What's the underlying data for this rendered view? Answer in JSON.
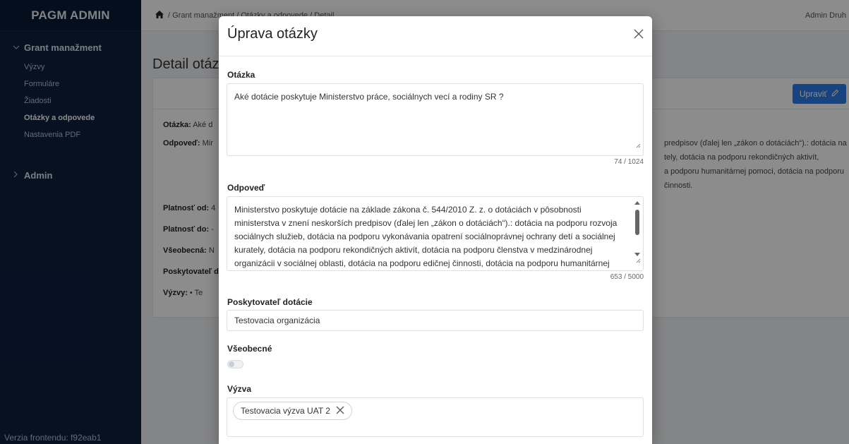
{
  "sidebar": {
    "brand": "PAGM ADMIN",
    "group_grant": "Grant manažment",
    "items": [
      {
        "label": "Výzvy",
        "active": false
      },
      {
        "label": "Formuláre",
        "active": false
      },
      {
        "label": "Žiadosti",
        "active": false
      },
      {
        "label": "Otázky a odpovede",
        "active": true
      },
      {
        "label": "Nastavenia PDF",
        "active": false
      }
    ],
    "group_admin": "Admin",
    "footer": "Verzia frontendu: f92eab1"
  },
  "topbar": {
    "breadcrumb": "/ Grant manažment / Otázky a odpovede / Detail",
    "user": "Admin Druh"
  },
  "page": {
    "title": "Detail otáz",
    "edit_label": "Upraviť",
    "rows": [
      {
        "label": "Otázka:",
        "value": "Aké d"
      },
      {
        "label": "Odpoveď:",
        "value": "Mir"
      },
      {
        "label": "Platnosť od:",
        "value": "4"
      },
      {
        "label": "Platnosť do:",
        "value": "-"
      },
      {
        "label": "Všeobecná:",
        "value": "N"
      },
      {
        "label": "Poskytovateľ d",
        "value": ""
      },
      {
        "label": "Výzvy:",
        "value": "• Te"
      }
    ],
    "answer_lines": [
      "predpisov (ďalej len „zákon o dotáciách“).: dotácia na",
      "tely, dotácia na podporu rekondičných aktivít,",
      "a podporu humanitárnej pomoci, dotácia na podporu",
      "činnosti."
    ]
  },
  "modal": {
    "title": "Úprava otázky",
    "question_label": "Otázka",
    "question_value": "Aké dotácie poskytuje Ministerstvo práce, sociálnych vecí a rodiny SR ?",
    "question_counter": "74 / 1024",
    "answer_label": "Odpoveď",
    "answer_value": "Ministerstvo poskytuje dotácie na základe zákona č. 544/2010 Z. z. o dotáciách v pôsobnosti ministerstva v znení neskorších predpisov (ďalej len „zákon o dotáciách“).: dotácia na podporu rozvoja sociálnych služieb, dotácia na podporu vykonávania opatrení sociálnoprávnej ochrany detí a sociálnej kurately, dotácia na podporu rekondičných aktivít, dotácia na podporu členstva v medzinárodnej organizácii v sociálnej oblasti, dotácia na podporu edičnej činnosti, dotácia na podporu humanitárnej pomoci, dotácia na podporu",
    "answer_counter": "653 / 5000",
    "provider_label": "Poskytovateľ dotácie",
    "provider_value": "Testovacia organizácia",
    "general_label": "Všeobecné",
    "general_on": false,
    "call_label": "Výzva",
    "call_chip": "Testovacia výzva UAT 2"
  },
  "colors": {
    "sidebar_bg": "#0b1f3f",
    "accent": "#2f7be6"
  }
}
